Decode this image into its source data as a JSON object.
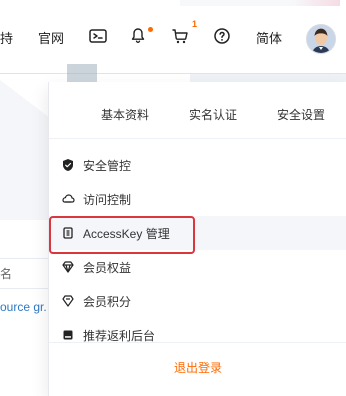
{
  "topbar": {
    "left_text": "持",
    "console_link": "官网",
    "lang": "简体"
  },
  "badges": {
    "cart_count": "1"
  },
  "icons": {
    "terminal": "terminal-icon",
    "bell": "bell-icon",
    "cart": "cart-icon",
    "help": "help-icon",
    "avatar": "avatar-icon"
  },
  "panel": {
    "tabs": [
      "基本资料",
      "实名认证",
      "安全设置"
    ],
    "menu": [
      {
        "label": "安全管控",
        "icon": "shield-icon"
      },
      {
        "label": "访问控制",
        "icon": "cloud-access-icon"
      },
      {
        "label": "AccessKey 管理",
        "icon": "key-icon"
      },
      {
        "label": "会员权益",
        "icon": "diamond-icon"
      },
      {
        "label": "会员积分",
        "icon": "gem-icon"
      },
      {
        "label": "推荐返利后台",
        "icon": "square-icon"
      }
    ],
    "logout_label": "退出登录"
  },
  "background": {
    "name_label": "名",
    "source_link": "ource gr."
  },
  "colors": {
    "accent": "#ff6a00",
    "highlight": "#f4f6fa",
    "red_box": "#d9363e"
  }
}
